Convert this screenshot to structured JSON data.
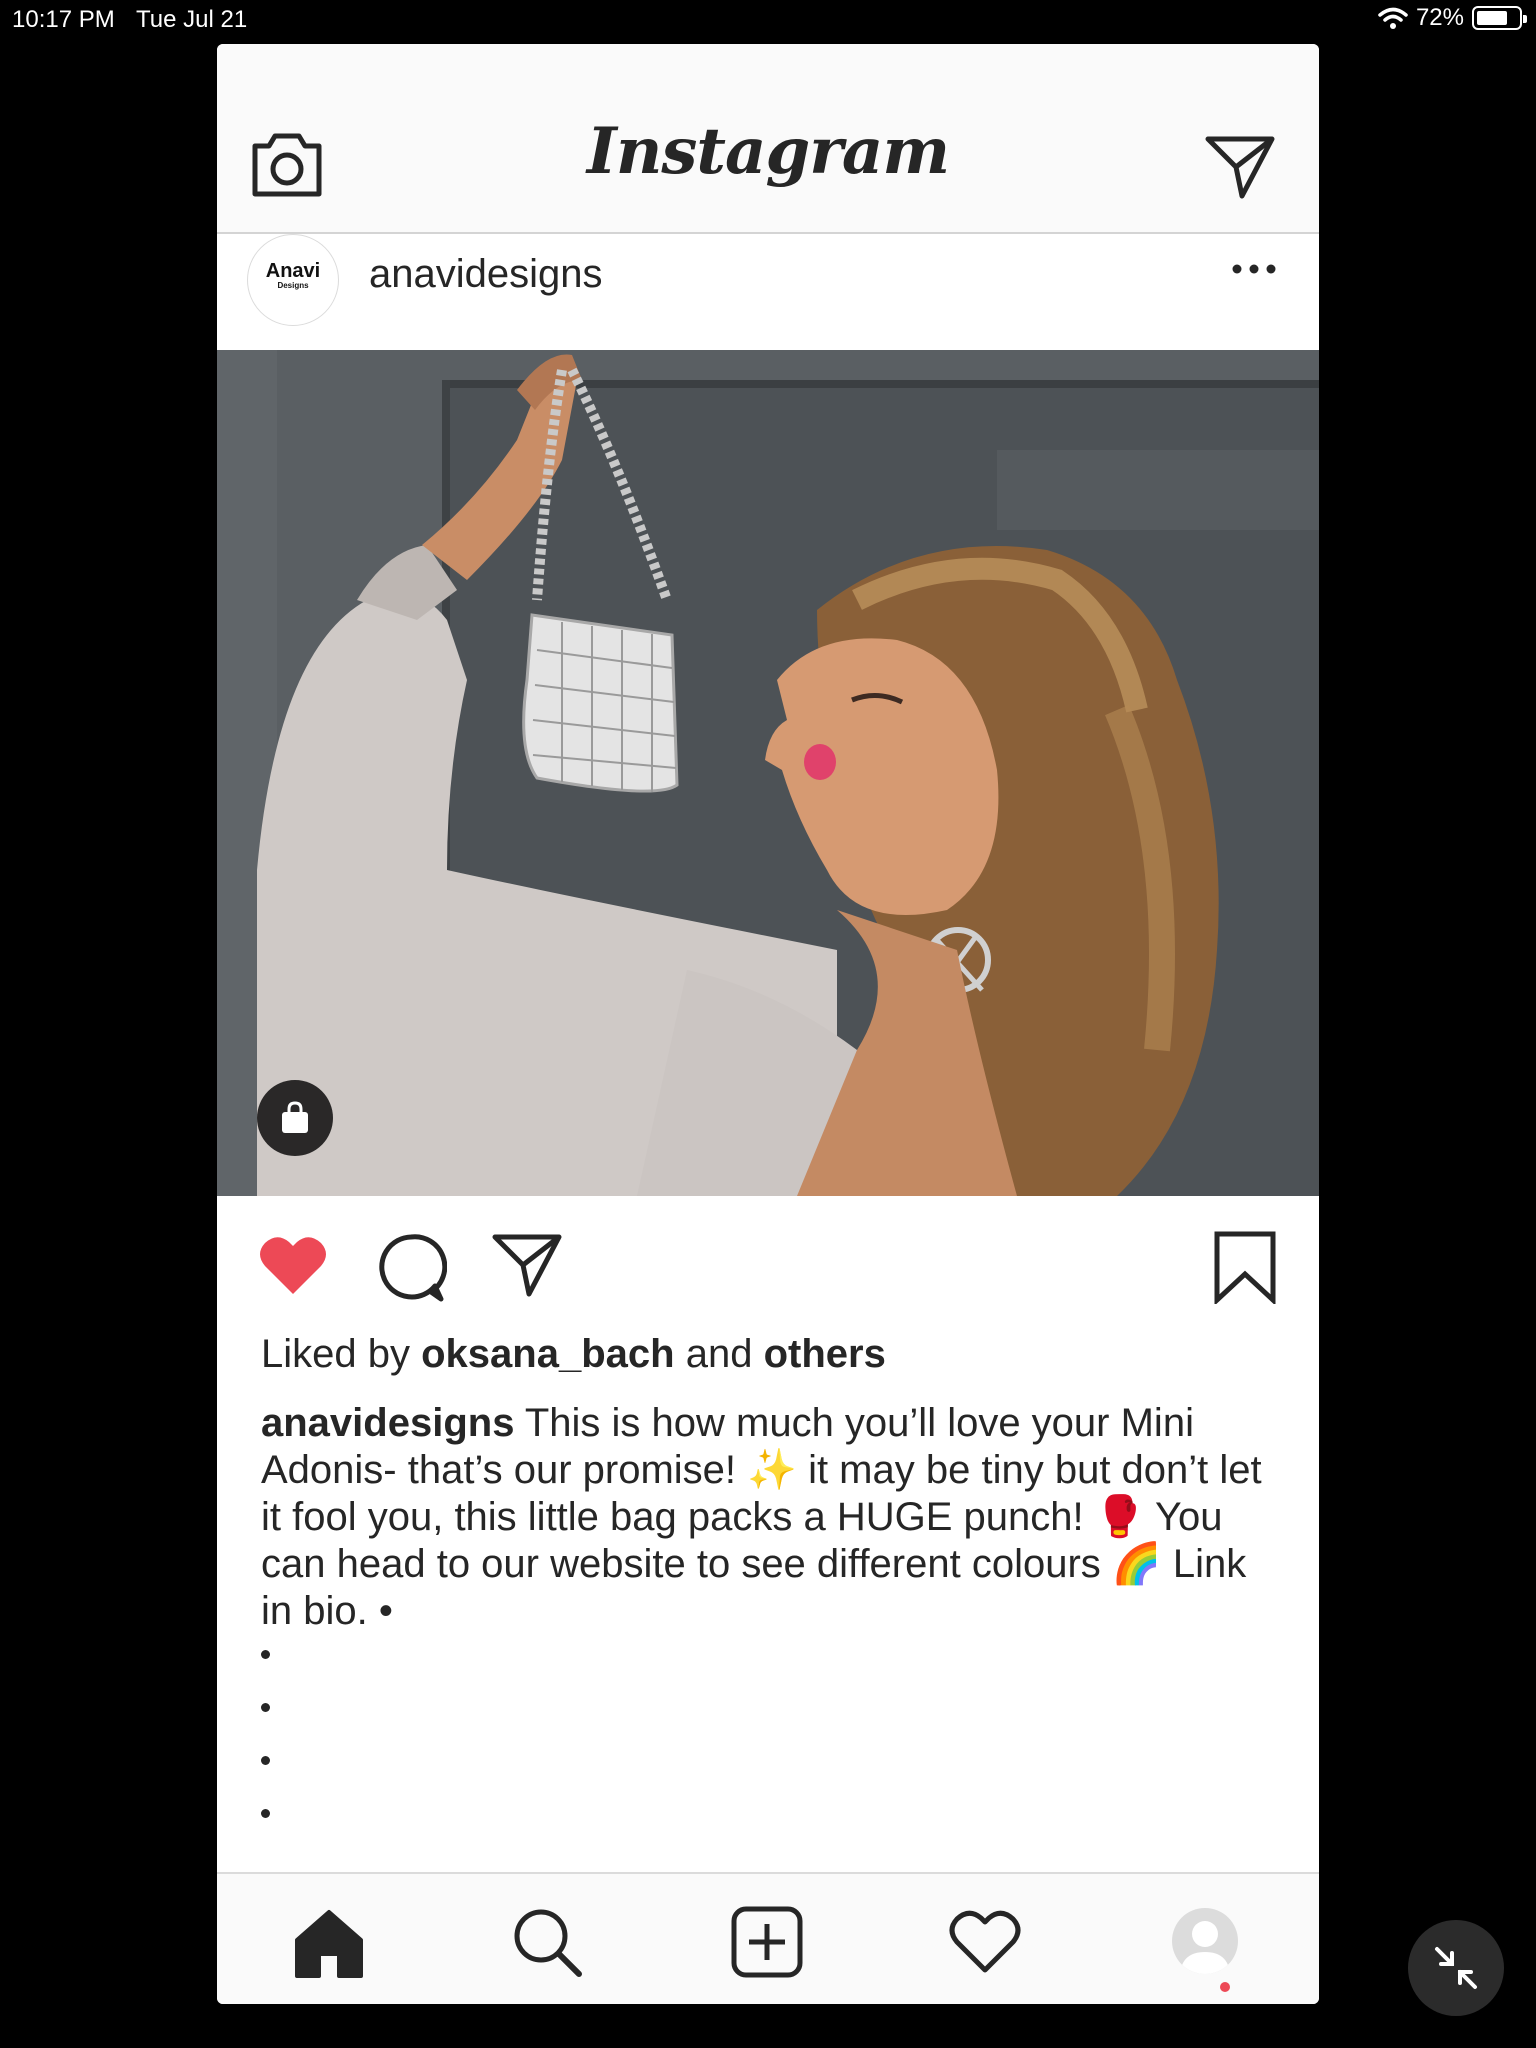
{
  "status_bar": {
    "time": "10:17 PM",
    "date": "Tue Jul 21",
    "battery": "72%",
    "battery_level": 0.72
  },
  "header": {
    "logo": "Instagram"
  },
  "post": {
    "avatar_brand": "Anavi",
    "avatar_sub": "Designs",
    "username": "anavidesigns",
    "liked_by_prefix": "Liked by",
    "liked_by_user": "oksana_bach",
    "liked_by_and": "and",
    "liked_by_others": "others",
    "caption_user": "anavidesigns",
    "caption_text": "This is how much you’ll love your Mini Adonis- that’s our promise! ✨ it may be tiny but don’t let it fool you, this little bag packs a HUGE punch! 🥊 You can head to our website to see different colours 🌈 Link in bio. •",
    "liked": true,
    "like_color": "#ed4956"
  },
  "icons": {
    "camera": "camera-icon",
    "direct": "paper-plane-icon",
    "more": "more-horizontal-icon",
    "shopping": "shopping-bag-icon",
    "like": "heart-filled-icon",
    "comment": "comment-icon",
    "share": "paper-plane-icon",
    "save": "bookmark-icon",
    "home": "home-icon",
    "search": "search-icon",
    "add": "add-post-icon",
    "activity": "heart-outline-icon",
    "profile": "profile-icon",
    "minimize": "minimize-arrows-icon"
  }
}
